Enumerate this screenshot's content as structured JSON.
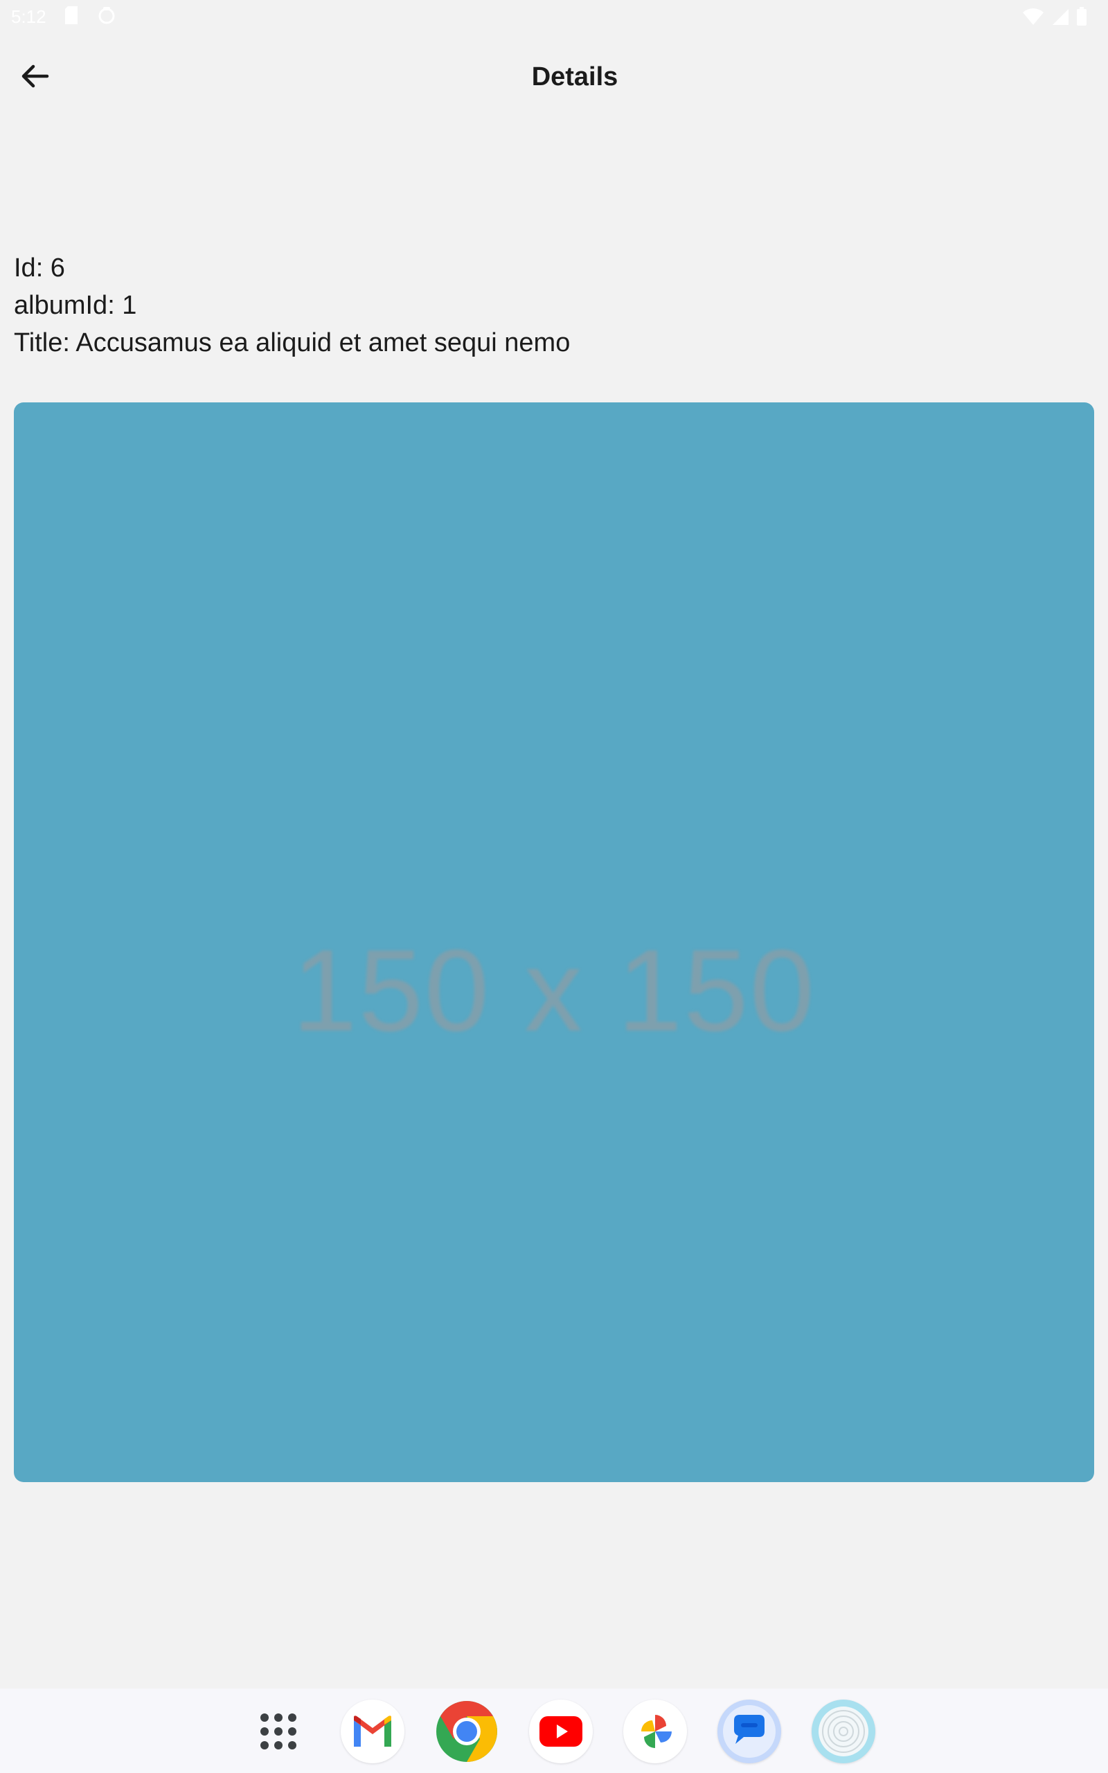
{
  "status_bar": {
    "time": "5:12"
  },
  "app_bar": {
    "title": "Details",
    "back_icon": "arrow-back-icon"
  },
  "details": {
    "id_line": "Id: 6",
    "album_line": "albumId: 1",
    "title_line": "Title: Accusamus ea aliquid et amet sequi nemo"
  },
  "photo": {
    "placeholder_text": "150 x 150",
    "background_color": "#58a8c4"
  },
  "dock": {
    "apps": [
      {
        "name": "app-drawer",
        "icon": "grid-dots-icon"
      },
      {
        "name": "gmail",
        "icon": "gmail-icon"
      },
      {
        "name": "chrome",
        "icon": "chrome-icon"
      },
      {
        "name": "youtube",
        "icon": "youtube-icon"
      },
      {
        "name": "photos",
        "icon": "photos-pinwheel-icon"
      },
      {
        "name": "messages",
        "icon": "messages-icon"
      },
      {
        "name": "unknown-app",
        "icon": "target-circle-icon"
      }
    ]
  }
}
